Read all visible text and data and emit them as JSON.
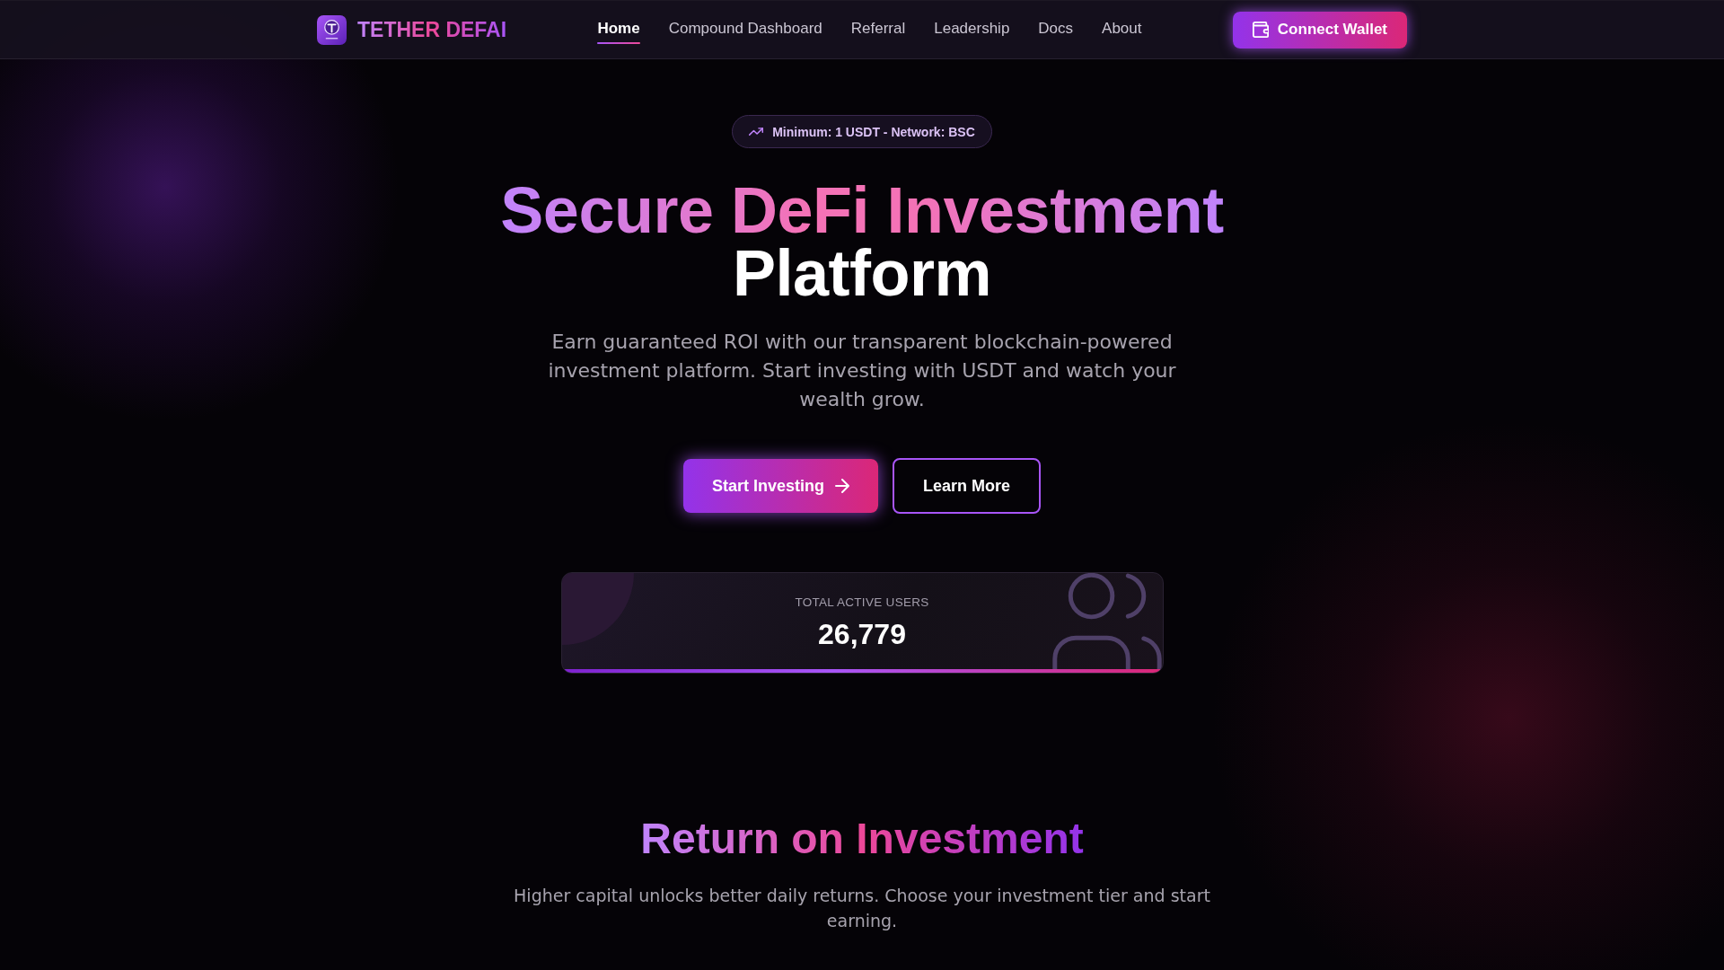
{
  "nav": {
    "brand": "TETHER DEFAI",
    "links": [
      {
        "label": "Home",
        "selected": true
      },
      {
        "label": "Compound Dashboard",
        "selected": false
      },
      {
        "label": "Referral",
        "selected": false
      },
      {
        "label": "Leadership",
        "selected": false
      },
      {
        "label": "Docs",
        "selected": false
      },
      {
        "label": "About",
        "selected": false
      }
    ],
    "connect_button": "Connect Wallet"
  },
  "hero": {
    "badge": "Minimum: 1 USDT - Network: BSC",
    "heading": {
      "highlight": "Secure DeFi Investment",
      "rest": "Platform"
    },
    "description": "Earn guaranteed ROI with our transparent blockchain-powered investment platform. Start investing with USDT and watch your wealth grow.",
    "buttons": [
      {
        "label": "Start Investing",
        "kind": "primary"
      },
      {
        "label": "Learn More",
        "kind": "outline"
      }
    ],
    "stat": {
      "label": "TOTAL ACTIVE USERS",
      "value": "26,779"
    }
  },
  "roi_section": {
    "title": "Return on Investment",
    "subtitle": "Higher capital unlocks better daily returns. Choose your investment tier and start earning."
  }
}
